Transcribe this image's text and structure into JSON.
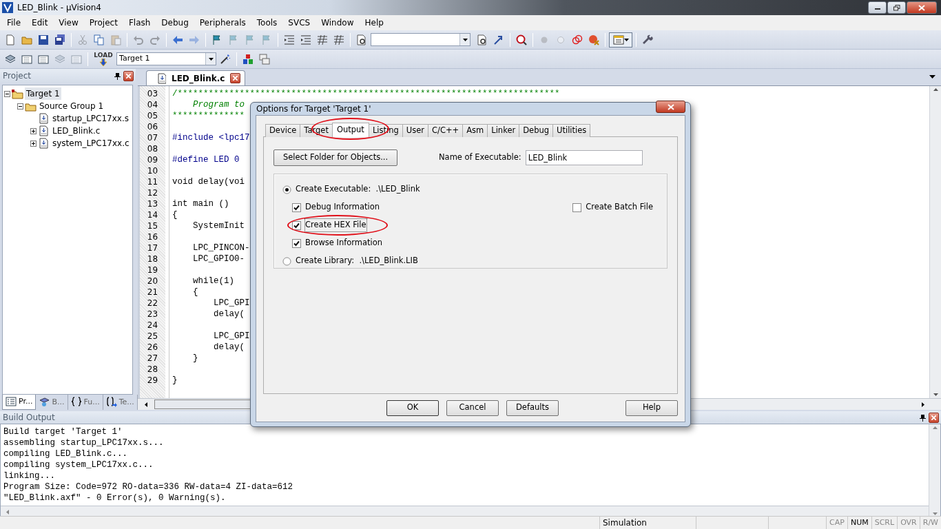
{
  "window": {
    "title": "LED_Blink  - µVision4"
  },
  "menu": [
    "File",
    "Edit",
    "View",
    "Project",
    "Flash",
    "Debug",
    "Peripherals",
    "Tools",
    "SVCS",
    "Window",
    "Help"
  ],
  "toolbar_1": {
    "buttons": [
      {
        "disabled": false
      },
      {
        "disabled": false
      },
      {
        "disabled": false
      },
      {
        "disabled": false
      },
      {
        "disabled": true
      },
      {
        "disabled": false
      },
      {
        "disabled": true
      },
      {
        "disabled": true
      },
      {
        "disabled": true
      },
      {
        "disabled": false
      },
      {
        "disabled": true
      },
      {
        "disabled": false
      },
      {
        "disabled": true
      },
      {
        "disabled": true
      },
      {
        "disabled": true
      },
      {
        "disabled": false
      },
      {
        "disabled": false
      },
      {
        "disabled": false
      },
      {
        "disabled": false
      },
      {
        "disabled": false
      },
      {
        "disabled": false
      },
      {
        "disabled": false
      },
      {
        "disabled": false
      },
      {
        "disabled": true
      },
      {
        "disabled": true
      },
      {
        "disabled": false
      },
      {
        "disabled": false
      },
      {
        "disabled": false
      },
      {
        "disabled": false
      }
    ]
  },
  "toolbar_2": {
    "load_label": "LOAD",
    "target": "Target 1",
    "buttons": [
      {
        "disabled": false
      },
      {
        "disabled": false
      },
      {
        "disabled": false
      },
      {
        "disabled": true
      },
      {
        "disabled": true
      },
      {
        "disabled": false
      },
      {
        "disabled": false
      },
      {
        "disabled": false
      },
      {
        "disabled": false
      }
    ]
  },
  "project_pane": {
    "title": "Project",
    "tree": [
      {
        "label": "Target 1",
        "kind": "target",
        "expanded": true,
        "selected": true,
        "children": [
          {
            "label": "Source Group 1",
            "kind": "group",
            "expanded": true,
            "selected": false,
            "children": [
              {
                "label": "startup_LPC17xx.s",
                "kind": "file",
                "selected": false
              },
              {
                "label": "LED_Blink.c",
                "kind": "file",
                "expanded": false,
                "selected": false
              },
              {
                "label": "system_LPC17xx.c",
                "kind": "file",
                "expanded": false,
                "selected": false
              }
            ]
          }
        ]
      }
    ],
    "tabs": [
      {
        "label": "Pr...",
        "kind": "project",
        "selected": true
      },
      {
        "label": "B...",
        "kind": "books",
        "selected": false
      },
      {
        "label": "Fu...",
        "kind": "functions",
        "selected": false
      },
      {
        "label": "Te...",
        "kind": "templates",
        "selected": false
      }
    ]
  },
  "editor": {
    "tabs": [
      {
        "label": "LED_Blink.c",
        "selected": true
      }
    ],
    "lines": [
      {
        "number": "03",
        "kind": "comment",
        "text": "/**************************************************************************"
      },
      {
        "number": "04",
        "kind": "comment",
        "text": "    Program to"
      },
      {
        "number": "05",
        "kind": "comment",
        "text": "**************"
      },
      {
        "number": "06",
        "kind": "code"
      },
      {
        "number": "07",
        "kind": "directive",
        "text": "#include <lpc17"
      },
      {
        "number": "08",
        "kind": "code"
      },
      {
        "number": "09",
        "kind": "directive",
        "text": "#define LED 0"
      },
      {
        "number": "10",
        "kind": "code"
      },
      {
        "number": "11",
        "kind": "code",
        "text": "void delay(voi"
      },
      {
        "number": "12",
        "kind": "code"
      },
      {
        "number": "13",
        "kind": "code",
        "text": "int main ()"
      },
      {
        "number": "14",
        "kind": "code",
        "text": "{"
      },
      {
        "number": "15",
        "kind": "code",
        "text": "    SystemInit"
      },
      {
        "number": "16",
        "kind": "code"
      },
      {
        "number": "17",
        "kind": "code",
        "text": "    LPC_PINCON-"
      },
      {
        "number": "18",
        "kind": "code",
        "text": "    LPC_GPIO0-"
      },
      {
        "number": "19",
        "kind": "code"
      },
      {
        "number": "20",
        "kind": "code",
        "text": "    while(1)"
      },
      {
        "number": "21",
        "kind": "code",
        "text": "    {"
      },
      {
        "number": "22",
        "kind": "code",
        "text": "        LPC_GPI"
      },
      {
        "number": "23",
        "kind": "code",
        "text": "        delay("
      },
      {
        "number": "24",
        "kind": "code"
      },
      {
        "number": "25",
        "kind": "code",
        "text": "        LPC_GPI"
      },
      {
        "number": "26",
        "kind": "code",
        "text": "        delay("
      },
      {
        "number": "27",
        "kind": "code",
        "text": "    }"
      },
      {
        "number": "28",
        "kind": "code"
      },
      {
        "number": "29",
        "kind": "code",
        "text": "}"
      }
    ]
  },
  "build_output": {
    "title": "Build Output",
    "lines": [
      "Build target 'Target 1'",
      "assembling startup_LPC17xx.s...",
      "compiling LED_Blink.c...",
      "compiling system_LPC17xx.c...",
      "linking...",
      "Program Size: Code=972 RO-data=336 RW-data=4 ZI-data=612",
      "\"LED_Blink.axf\" - 0 Error(s), 0 Warning(s)."
    ]
  },
  "status_bar": {
    "mode": "Simulation",
    "indicators": [
      {
        "label": "CAP",
        "on": false
      },
      {
        "label": "NUM",
        "on": true
      },
      {
        "label": "SCRL",
        "on": false
      },
      {
        "label": "OVR",
        "on": false
      },
      {
        "label": "R/W",
        "on": false
      }
    ]
  },
  "dialog": {
    "title": "Options for Target 'Target 1'",
    "tabs": [
      {
        "label": "Device",
        "selected": false,
        "circled": false
      },
      {
        "label": "Target",
        "selected": false,
        "circled": false
      },
      {
        "label": "Output",
        "selected": true,
        "circled": true
      },
      {
        "label": "Listing",
        "selected": false,
        "circled": false
      },
      {
        "label": "User",
        "selected": false,
        "circled": false
      },
      {
        "label": "C/C++",
        "selected": false,
        "circled": false
      },
      {
        "label": "Asm",
        "selected": false,
        "circled": false
      },
      {
        "label": "Linker",
        "selected": false,
        "circled": false
      },
      {
        "label": "Debug",
        "selected": false,
        "circled": false
      },
      {
        "label": "Utilities",
        "selected": false,
        "circled": false
      }
    ],
    "folder_button": "Select Folder for Objects...",
    "name_label": "Name of Executable:",
    "name_value": "LED_Blink",
    "options": [
      {
        "kind": "radio",
        "label": "Create Executable:  .\\LED_Blink",
        "selected": true,
        "circled": false
      },
      {
        "kind": "checkbox",
        "label": "Debug Information",
        "checked": true,
        "circled": false
      },
      {
        "kind": "checkbox",
        "label": "Create HEX File",
        "checked": true,
        "circled": true
      },
      {
        "kind": "checkbox",
        "label": "Browse Information",
        "checked": true,
        "circled": false
      },
      {
        "kind": "radio",
        "label": "Create Library:  .\\LED_Blink.LIB",
        "selected": false,
        "circled": false
      }
    ],
    "batch": {
      "label": "Create Batch File",
      "checked": false
    },
    "buttons": [
      {
        "label": "OK",
        "kind": "default"
      },
      {
        "label": "Cancel",
        "kind": "normal"
      },
      {
        "label": "Defaults",
        "kind": "normal"
      },
      {
        "label": "Help",
        "kind": "help"
      }
    ]
  }
}
